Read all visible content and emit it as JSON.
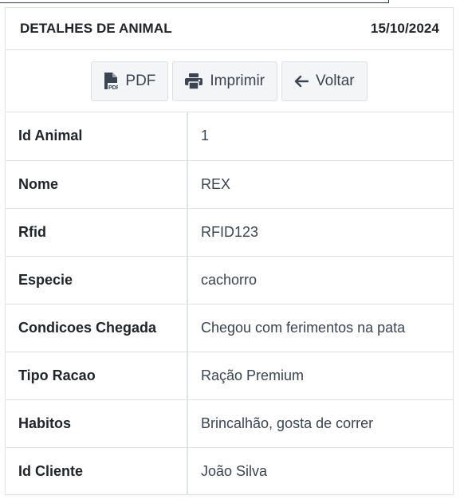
{
  "header": {
    "title": "DETALHES DE ANIMAL",
    "date": "15/10/2024"
  },
  "toolbar": {
    "pdf_label": "PDF",
    "print_label": "Imprimir",
    "back_label": "Voltar",
    "icons": [
      "pdf-file-icon",
      "printer-icon",
      "arrow-left-icon"
    ]
  },
  "details": [
    {
      "label": "Id Animal",
      "value": "1"
    },
    {
      "label": "Nome",
      "value": "REX"
    },
    {
      "label": "Rfid",
      "value": "RFID123"
    },
    {
      "label": "Especie",
      "value": "cachorro"
    },
    {
      "label": "Condicoes Chegada",
      "value": "Chegou com ferimentos na pata"
    },
    {
      "label": "Tipo Racao",
      "value": "Ração Premium"
    },
    {
      "label": "Habitos",
      "value": "Brincalhão, gosta de correr"
    },
    {
      "label": "Id Cliente",
      "value": "João Silva"
    }
  ]
}
